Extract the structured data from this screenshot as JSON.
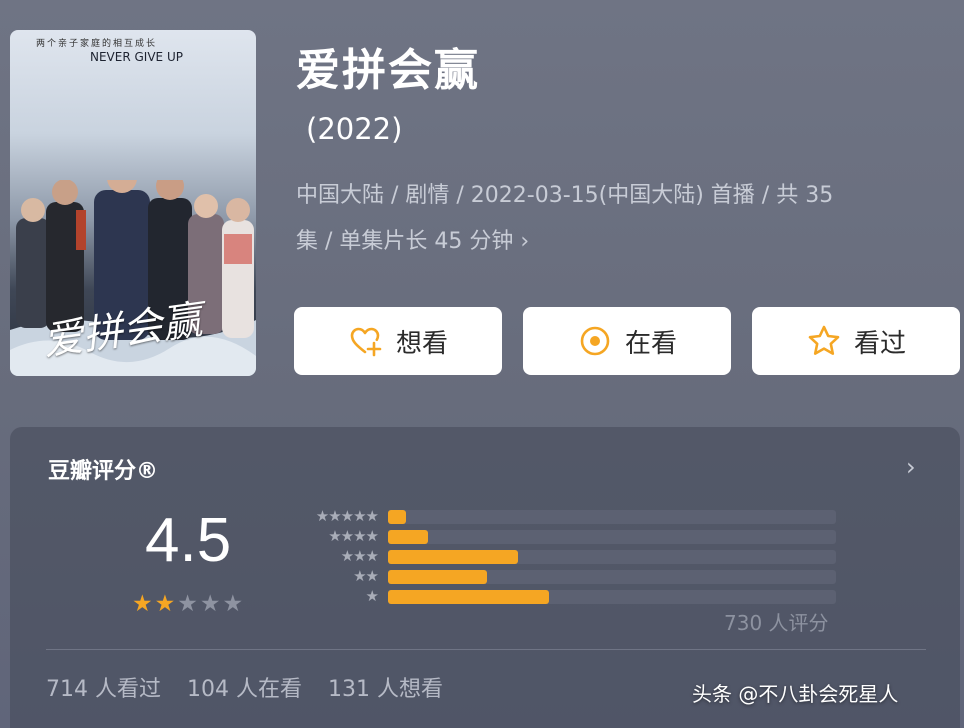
{
  "poster": {
    "top_text": "两个亲子家庭的相互成长",
    "tagline": "NEVER GIVE UP",
    "calligraphy": "爱拼会赢"
  },
  "show": {
    "title": "爱拼会赢",
    "year": "(2022)",
    "meta_line1": "中国大陆 / 剧情 / 2022-03-15(中国大陆) 首播 / 共 35",
    "meta_line2": "集 / 单集片长 45 分钟 ›"
  },
  "actions": [
    {
      "label": "想看",
      "icon": "heart-plus-icon"
    },
    {
      "label": "在看",
      "icon": "target-circle-icon"
    },
    {
      "label": "看过",
      "icon": "star-outline-icon"
    }
  ],
  "rating": {
    "title": "豆瓣评分®",
    "chevron": "›",
    "score": "4.5",
    "stars_filled": 2,
    "stars_total": 5,
    "distribution": [
      {
        "stars": "★★★★★",
        "fraction": 0.04
      },
      {
        "stars": "★★★★",
        "fraction": 0.09
      },
      {
        "stars": "★★★",
        "fraction": 0.29
      },
      {
        "stars": "★★",
        "fraction": 0.22
      },
      {
        "stars": "★",
        "fraction": 0.36
      }
    ],
    "count_label": "730 人评分"
  },
  "stats": {
    "watched": "714 人看过",
    "watching": "104 人在看",
    "want": "131 人想看"
  },
  "watermark": "头条 @不八卦会死星人",
  "colors": {
    "accent": "#f5a623",
    "panel": "#444958",
    "background": "#6b7080"
  }
}
